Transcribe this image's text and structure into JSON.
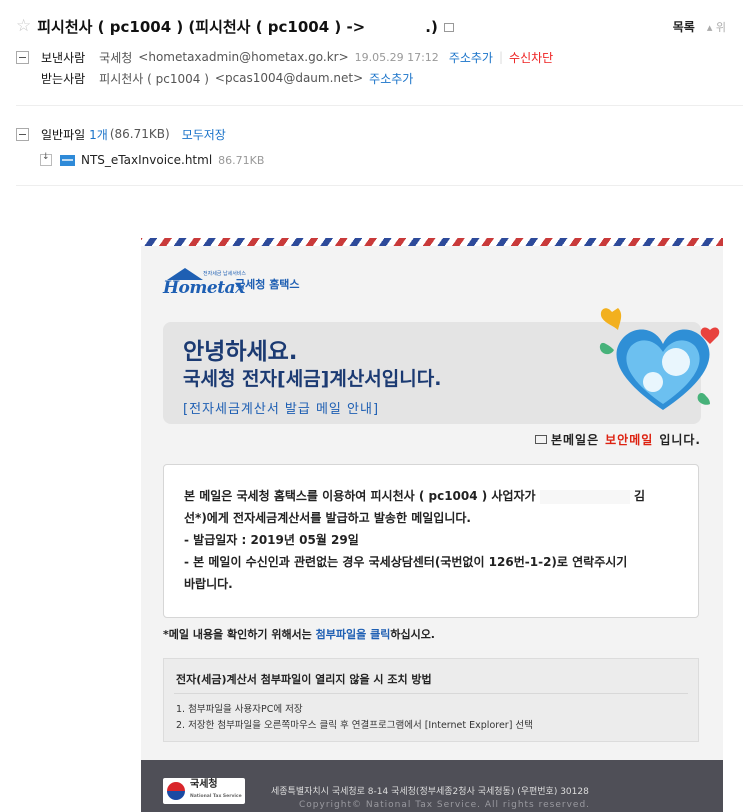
{
  "header": {
    "subject_part1": "피시천사 ( pc1004 )  (피시천사 ( pc1004 ) ->",
    "subject_part2": ".)",
    "list_label": "목록",
    "prev_label": "▴ 위"
  },
  "sender": {
    "label": "보낸사람",
    "name": "국세청",
    "email": "<hometaxadmin@hometax.go.kr>",
    "date": "19.05.29 17:12",
    "add_contact": "주소추가",
    "block": "수신차단"
  },
  "recipient": {
    "label": "받는사람",
    "name": "피시천사 ( pc1004 )",
    "email": "<pcas1004@daum.net>",
    "add_contact": "주소추가"
  },
  "attachments": {
    "label": "일반파일",
    "count": "1개",
    "total_size": "(86.71KB)",
    "save_all": "모두저장",
    "files": [
      {
        "name": "NTS_eTaxInvoice.html",
        "size": "86.71KB"
      }
    ]
  },
  "mail": {
    "logo_small": "전자세금 납세서비스",
    "logo_word": "Hometax",
    "logo_text": "국세청 홈택스",
    "greeting_1": "안녕하세요.",
    "greeting_2": "국세청 전자[세금]계산서입니다.",
    "greeting_3": "[전자세금계산서 발급 메일 안내]",
    "secure_prefix": "본메일은",
    "secure_red": "보안메일",
    "secure_suffix": "입니다.",
    "notice_1a": "본 메일은 국세청 홈택스를 이용하여 피시천사 ( pc1004 )  사업자가",
    "notice_1b": "김",
    "notice_2": "선*)에게 전자세금계산서를 발급하고 발송한 메일입니다.",
    "notice_3": "- 발급일자 : 2019년 05월 29일",
    "notice_4": "- 본 메일이 수신인과 관련없는 경우 국세상담센터(국번없이 126번-1-2)로 연락주시기",
    "notice_5": "바랍니다.",
    "click_prefix": "*메일 내용을 확인하기 위해서는",
    "click_link": "첨부파일을 클릭",
    "click_suffix": "하십시오.",
    "howto_title": "전자(세금)계산서 첨부파일이 열리지 않을 시 조치 방법",
    "howto_steps": [
      "1.  첨부파일을 사용자PC에 저장",
      "2.  저장한 첨부파일을 오른쪽마우스 클릭 후 연결프로그램에서 [Internet Explorer] 선택"
    ],
    "footer_logo": "국세청",
    "footer_logo_sub": "National Tax Service",
    "footer_address": "세종특별자치시 국세청로 8-14 국세청(정부세종2청사 국세청동) (우편번호) 30128",
    "footer_copyright": "Copyright© National Tax Service. All rights reserved."
  },
  "colors": {
    "link_blue": "#1a73c9",
    "block_red": "#ee2222",
    "hometax_blue": "#1e5fb3",
    "footer_bg": "#4f4f57"
  }
}
